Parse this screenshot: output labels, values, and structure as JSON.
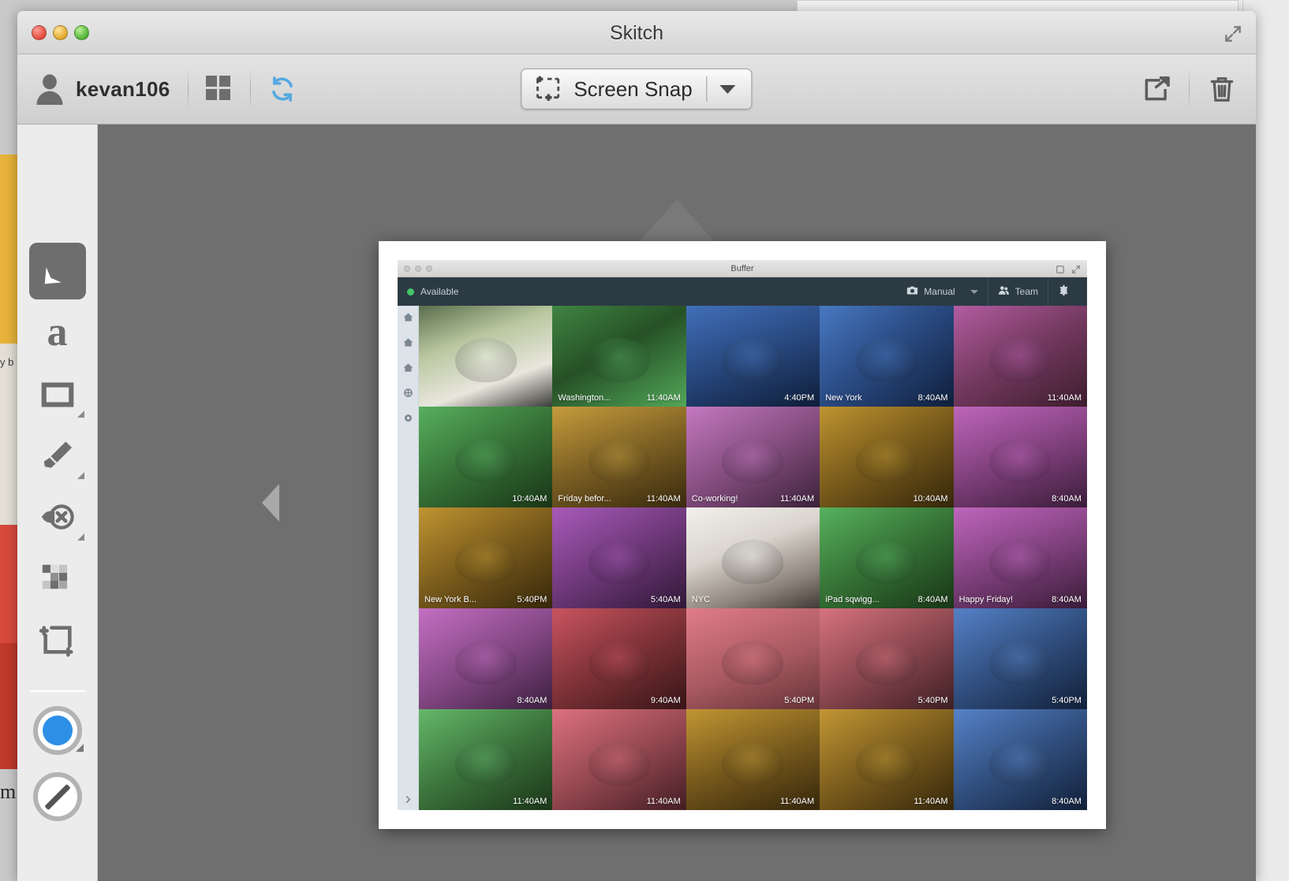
{
  "window": {
    "app_title": "Skitch",
    "traffic_lights": [
      "close-light",
      "minimize-light",
      "zoom-light"
    ],
    "fullscreen_icon": "fullscreen-icon"
  },
  "toolbar": {
    "username": "kevan106",
    "avatar_icon": "user-avatar-icon",
    "grid_icon": "grid-view-icon",
    "sync_icon": "sync-icon",
    "snap_label": "Screen Snap",
    "snap_icon": "crop-selection-icon",
    "snap_caret": "chevron-down-icon",
    "share_icon": "share-icon",
    "trash_icon": "trash-icon"
  },
  "tools": [
    {
      "name": "arrow-tool",
      "icon": "arrow-icon",
      "active": true,
      "has_disclosure": false
    },
    {
      "name": "text-tool",
      "icon": "text-a-icon",
      "active": false,
      "has_disclosure": false
    },
    {
      "name": "shape-tool",
      "icon": "rectangle-icon",
      "active": false,
      "has_disclosure": true
    },
    {
      "name": "highlighter-tool",
      "icon": "marker-pen-icon",
      "active": false,
      "has_disclosure": true
    },
    {
      "name": "stamp-tool",
      "icon": "stamp-x-icon",
      "active": false,
      "has_disclosure": true
    },
    {
      "name": "pixelate-tool",
      "icon": "pixelate-icon",
      "active": false,
      "has_disclosure": false
    },
    {
      "name": "crop-tool",
      "icon": "crop-icon",
      "active": false,
      "has_disclosure": false
    }
  ],
  "tool_options": {
    "color_swatch": {
      "name": "color-swatch",
      "color": "#2e8fe6",
      "has_disclosure": true
    },
    "stroke_swatch": {
      "name": "stroke-width-swatch",
      "has_disclosure": false
    }
  },
  "canvas": {
    "prev_arrow": "previous-image-arrow",
    "next_arrow": "next-image-arrow",
    "background_color": "#6f6f6f"
  },
  "artwork": {
    "title": "Buffer",
    "window_icons": [
      "restore-icon",
      "expand-icon"
    ],
    "header": {
      "status": "Available",
      "status_color": "#44c767",
      "mode_label": "Manual",
      "mode_icon": "camera-icon",
      "mode_caret": "chevron-down-icon",
      "team_label": "Team",
      "team_icon": "people-icon",
      "settings_icon": "gear-icon"
    },
    "sidebar_icons": [
      "home-icon",
      "home-icon",
      "home-icon",
      "refresh-icon",
      "gear-icon"
    ],
    "sidebar_collapse_icon": "chevron-right-icon",
    "grid": {
      "columns": 5,
      "rows": 5,
      "cells": [
        {
          "location": "",
          "time": "",
          "tint": "#ffffff",
          "opacity": 0.0,
          "photo_bg": "linear-gradient(160deg,#5a6d4b 0%,#b8c79f 35%,#e9e6dd 70%,#3b3b38 100%)"
        },
        {
          "location": "Washington...",
          "time": "11:40AM",
          "tint": "#46c35a",
          "opacity": 0.82,
          "photo_bg": "linear-gradient(150deg,#9aa48c 0%,#5c6450 45%,#c9cfbe 100%)"
        },
        {
          "location": "",
          "time": "4:40PM",
          "tint": "#2a6fd4",
          "opacity": 0.78,
          "photo_bg": "linear-gradient(160deg,#b9c6d6 0%,#6f7e90 50%,#2a3442 100%)"
        },
        {
          "location": "New York",
          "time": "8:40AM",
          "tint": "#2a6fd4",
          "opacity": 0.78,
          "photo_bg": "linear-gradient(140deg,#cdd6e0 0%,#7a889a 45%,#2b3644 100%)"
        },
        {
          "location": "",
          "time": "11:40AM",
          "tint": "#c541c2",
          "opacity": 0.75,
          "photo_bg": "linear-gradient(150deg,#d8cfc4 0%,#8a7f72 50%,#4a4038 100%)"
        },
        {
          "location": "",
          "time": "10:40AM",
          "tint": "#46c35a",
          "opacity": 0.8,
          "photo_bg": "linear-gradient(150deg,#cfd8c4 0%,#7e8a6e 50%,#39412e 100%)"
        },
        {
          "location": "Friday befor...",
          "time": "11:40AM",
          "tint": "#d7a521",
          "opacity": 0.8,
          "photo_bg": "linear-gradient(160deg,#e2d9c2 0%,#8d8470 50%,#40392c 100%)"
        },
        {
          "location": "Co-working!",
          "time": "11:40AM",
          "tint": "#c541c2",
          "opacity": 0.62,
          "photo_bg": "linear-gradient(150deg,#e5dfe2 0%,#9b8f96 50%,#453d44 100%)"
        },
        {
          "location": "",
          "time": "10:40AM",
          "tint": "#d7a521",
          "opacity": 0.86,
          "photo_bg": "linear-gradient(150deg,#ddd3b9 0%,#8a8066 50%,#3c3628 100%)"
        },
        {
          "location": "",
          "time": "8:40AM",
          "tint": "#c541c2",
          "opacity": 0.72,
          "photo_bg": "linear-gradient(160deg,#e3d9e2 0%,#9a8b97 50%,#463c45 100%)"
        },
        {
          "location": "New York B...",
          "time": "5:40PM",
          "tint": "#d7a521",
          "opacity": 0.85,
          "photo_bg": "linear-gradient(150deg,#ded4bb 0%,#8b8168 50%,#3e3729 100%)"
        },
        {
          "location": "",
          "time": "5:40AM",
          "tint": "#a83cc0",
          "opacity": 0.78,
          "photo_bg": "linear-gradient(150deg,#e6dee6 0%,#968a96 50%,#413a43 100%)"
        },
        {
          "location": "NYC",
          "time": "",
          "tint": "#ffffff",
          "opacity": 0.05,
          "photo_bg": "linear-gradient(160deg,#f2f0ec 0%,#d9d4cd 40%,#8d837a 75%,#403a35 100%)"
        },
        {
          "location": "iPad sqwigg...",
          "time": "8:40AM",
          "tint": "#46c35a",
          "opacity": 0.82,
          "photo_bg": "linear-gradient(150deg,#d4dcc8 0%,#808b6f 50%,#3a422e 100%)"
        },
        {
          "location": "Happy Friday!",
          "time": "8:40AM",
          "tint": "#c541c2",
          "opacity": 0.72,
          "photo_bg": "linear-gradient(160deg,#e4dae3 0%,#998b98 50%,#453c44 100%)"
        },
        {
          "location": "",
          "time": "8:40AM",
          "tint": "#c541c2",
          "opacity": 0.68,
          "photo_bg": "linear-gradient(150deg,#e8e0e8 0%,#9e92a0 50%,#463e4a 100%)"
        },
        {
          "location": "",
          "time": "9:40AM",
          "tint": "#e23a4e",
          "opacity": 0.78,
          "photo_bg": "linear-gradient(150deg,#ded2cf 0%,#8a7b78 50%,#3c3330 100%)"
        },
        {
          "location": "",
          "time": "5:40PM",
          "tint": "#e8566a",
          "opacity": 0.7,
          "photo_bg": "linear-gradient(160deg,#f0e8e6 0%,#b4a6a4 55%,#6b5f5d 100%)"
        },
        {
          "location": "",
          "time": "5:40PM",
          "tint": "#e8566a",
          "opacity": 0.72,
          "photo_bg": "linear-gradient(150deg,#e6dcda 0%,#97898a 50%,#423a3c 100%)"
        },
        {
          "location": "",
          "time": "5:40PM",
          "tint": "#2a6fd4",
          "opacity": 0.7,
          "photo_bg": "linear-gradient(150deg,#ccd6e2 0%,#73818f 50%,#2a3440 100%)"
        },
        {
          "location": "",
          "time": "11:40AM",
          "tint": "#46c35a",
          "opacity": 0.74,
          "photo_bg": "linear-gradient(150deg,#d8e0cc 0%,#7f8b70 50%,#39412f 100%)"
        },
        {
          "location": "",
          "time": "11:40AM",
          "tint": "#e8566a",
          "opacity": 0.74,
          "photo_bg": "linear-gradient(150deg,#ecdede 0%,#a18e90 50%,#49393d 100%)"
        },
        {
          "location": "",
          "time": "11:40AM",
          "tint": "#d7a521",
          "opacity": 0.84,
          "photo_bg": "linear-gradient(160deg,#ded4b8 0%,#8a8066 50%,#3d3629 100%)"
        },
        {
          "location": "",
          "time": "11:40AM",
          "tint": "#d7a521",
          "opacity": 0.84,
          "photo_bg": "linear-gradient(150deg,#e0d6bc 0%,#8d8368 50%,#3e372a 100%)"
        },
        {
          "location": "",
          "time": "8:40AM",
          "tint": "#2a6fd4",
          "opacity": 0.7,
          "photo_bg": "linear-gradient(150deg,#cdd7e3 0%,#74828f 50%,#2b3541 100%)"
        }
      ]
    }
  },
  "desktop": {
    "left_bleed_text": "m",
    "left_bleed_text_2": "y b",
    "left_strips": [
      "#e8b33a",
      "#d84a3c",
      "#c0392b"
    ]
  }
}
